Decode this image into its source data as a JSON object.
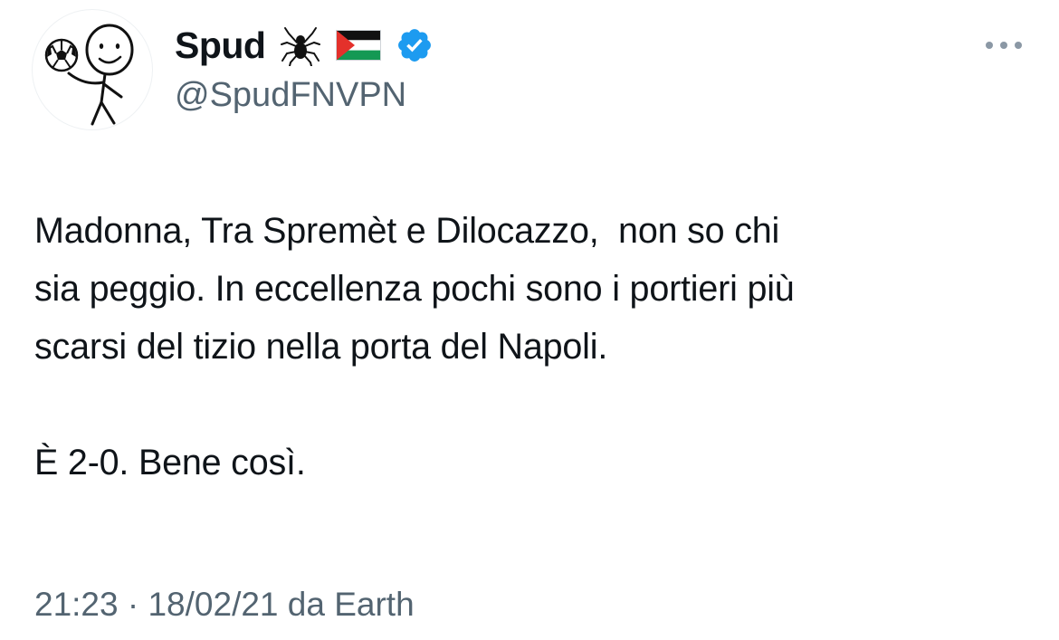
{
  "author": {
    "display_name": "Spud",
    "handle": "@SpudFNVPN",
    "name_emojis": [
      "spider-icon",
      "palestine-flag-icon"
    ],
    "verified": true,
    "verified_color": "#1d9bf0"
  },
  "tweet": {
    "line1": "Madonna, Tra Spremèt e Dilocazzo,  non so chi",
    "line2": "sia peggio. In eccellenza pochi sono i portieri più",
    "line3": "scarsi del tizio nella porta del Napoli.",
    "line4": "",
    "line5": "È 2-0. Bene così."
  },
  "meta": {
    "time": "21:23",
    "separator": "·",
    "date": "18/02/21",
    "source_prefix": "da",
    "source": "Earth"
  },
  "colors": {
    "text": "#0f1419",
    "secondary": "#536471",
    "background": "#ffffff"
  }
}
